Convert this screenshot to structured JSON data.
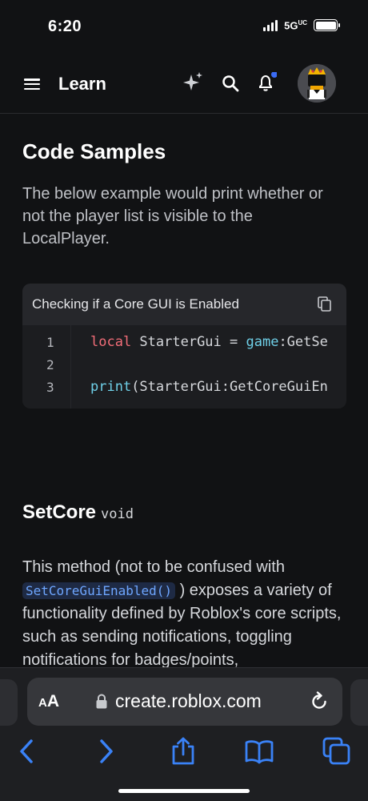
{
  "status_bar": {
    "time": "6:20",
    "network": "5G",
    "network_suffix": "UC"
  },
  "header": {
    "title": "Learn",
    "icons": [
      "menu-icon",
      "sparkle-icon",
      "search-icon",
      "bell-icon",
      "avatar"
    ],
    "notification_dot_color": "#3b6cf6"
  },
  "code_samples": {
    "title": "Code Samples",
    "description": "The below example would print whether or not the player list is visible to the LocalPlayer.",
    "card": {
      "title": "Checking if a Core GUI is Enabled",
      "line_numbers": [
        "1",
        "2",
        "3"
      ],
      "lines": [
        {
          "kw": "local",
          "rest": " StarterGui = ",
          "kw2": "game",
          "rest2": ":GetSe"
        },
        {
          "kw": "",
          "rest": "",
          "kw2": "",
          "rest2": ""
        },
        {
          "kw": "print",
          "rest": "(StarterGui:GetCoreGuiEn",
          "kw2": "",
          "rest2": ""
        }
      ]
    }
  },
  "method": {
    "name": "SetCore",
    "return_type": "void",
    "desc_before": "This method (not to be confused with ",
    "inline_code": "SetCoreGuiEnabled()",
    "desc_after": " ) exposes a variety of functionality defined by Roblox's core scripts, such as sending notifications, toggling notifications for badges/points,"
  },
  "browser": {
    "aa_label_small": "A",
    "aa_label_large": "A",
    "url": "create.roblox.com",
    "toolbar": [
      "back-icon",
      "forward-icon",
      "share-icon",
      "bookmarks-icon",
      "tabs-icon"
    ],
    "accent": "#3a82f7"
  }
}
